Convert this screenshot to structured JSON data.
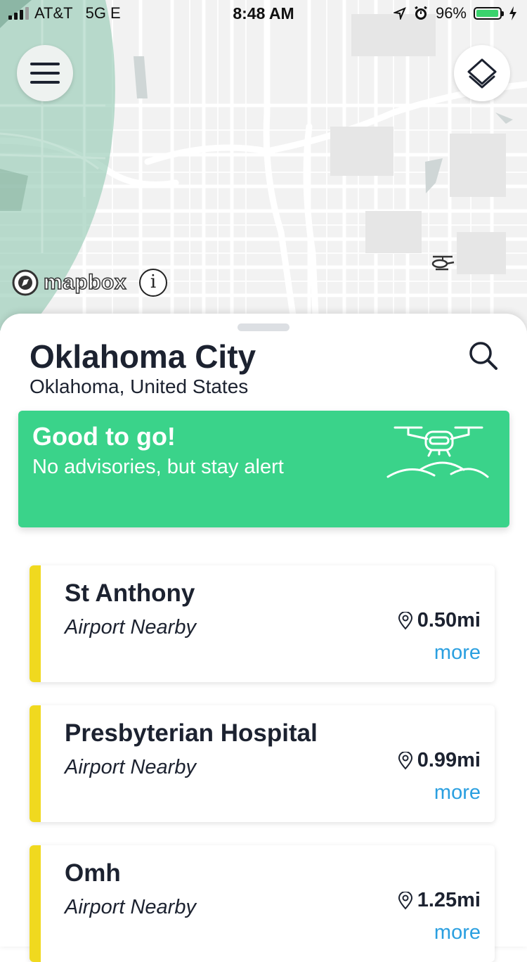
{
  "status_bar": {
    "carrier": "AT&T",
    "network": "5G E",
    "time": "8:48 AM",
    "battery": "96%",
    "battery_level": 0.96,
    "battery_color": "#3ad36d"
  },
  "map": {
    "attribution": "mapbox",
    "info_symbol": "i",
    "icons": {
      "menu": "hamburger-menu-icon",
      "layers": "layers-icon",
      "marker": "helicopter-icon"
    }
  },
  "location": {
    "city": "Oklahoma City",
    "region": "Oklahoma, United States"
  },
  "status": {
    "title": "Good to go!",
    "subtitle": "No advisories, but stay alert",
    "color": "#3ad38a"
  },
  "airports": [
    {
      "name": "St Anthony",
      "type": "Airport Nearby",
      "distance": "0.50mi",
      "more": "more"
    },
    {
      "name": "Presbyterian Hospital",
      "type": "Airport Nearby",
      "distance": "0.99mi",
      "more": "more"
    },
    {
      "name": "Omh",
      "type": "Airport Nearby",
      "distance": "1.25mi",
      "more": "more"
    }
  ],
  "colors": {
    "accent_link": "#2a9fe0",
    "advisory_stripe": "#f0d91f",
    "text_dark": "#1c2230"
  }
}
